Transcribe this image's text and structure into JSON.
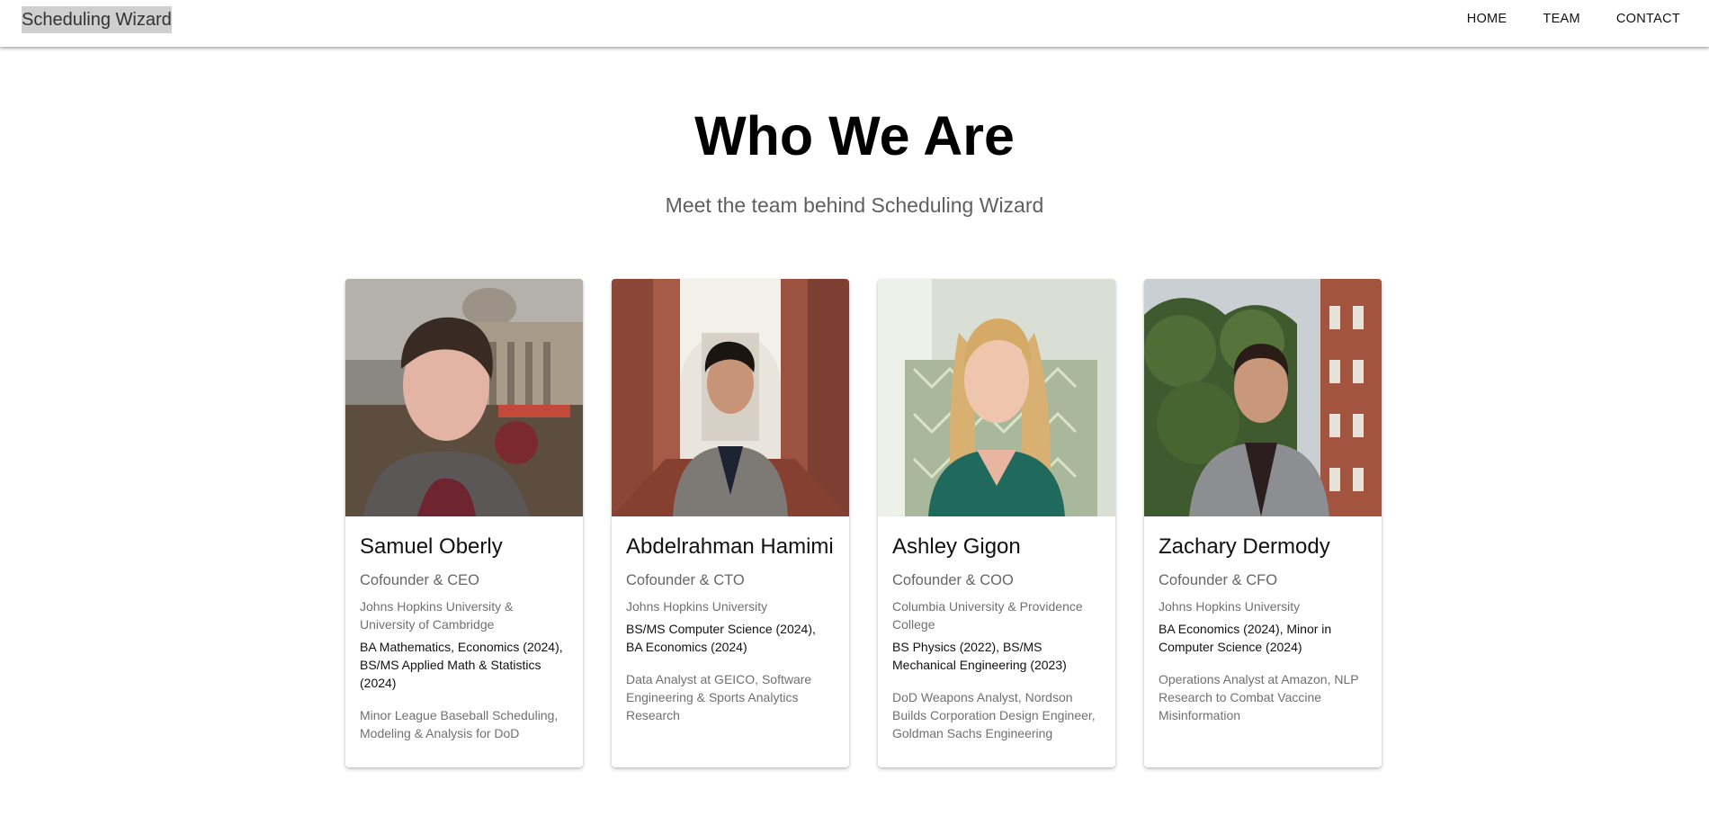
{
  "header": {
    "brand": "Scheduling Wizard",
    "nav": [
      "HOME",
      "TEAM",
      "CONTACT"
    ]
  },
  "hero": {
    "title": "Who We Are",
    "subtitle": "Meet the team behind Scheduling Wizard"
  },
  "team": [
    {
      "name": "Samuel Oberly",
      "role": "Cofounder & CEO",
      "school": "Johns Hopkins University & University of Cambridge",
      "degree": "BA Mathematics, Economics (2024), BS/MS Applied Math & Statistics (2024)",
      "experience": "Minor League Baseball Scheduling, Modeling & Analysis for DoD"
    },
    {
      "name": "Abdelrahman Hamimi",
      "role": "Cofounder & CTO",
      "school": "Johns Hopkins University",
      "degree": "BS/MS Computer Science (2024), BA Economics (2024)",
      "experience": "Data Analyst at GEICO, Software Engineering & Sports Analytics Research"
    },
    {
      "name": "Ashley Gigon",
      "role": "Cofounder & COO",
      "school": "Columbia University & Providence College",
      "degree": "BS Physics (2022), BS/MS Mechanical Engineering (2023)",
      "experience": "DoD Weapons Analyst, Nordson Builds Corporation Design Engineer, Goldman Sachs Engineering"
    },
    {
      "name": "Zachary Dermody",
      "role": "Cofounder & CFO",
      "school": "Johns Hopkins University",
      "degree": "BA Economics (2024), Minor in Computer Science (2024)",
      "experience": "Operations Analyst at Amazon, NLP Research to Combat Vaccine Misinformation"
    }
  ]
}
